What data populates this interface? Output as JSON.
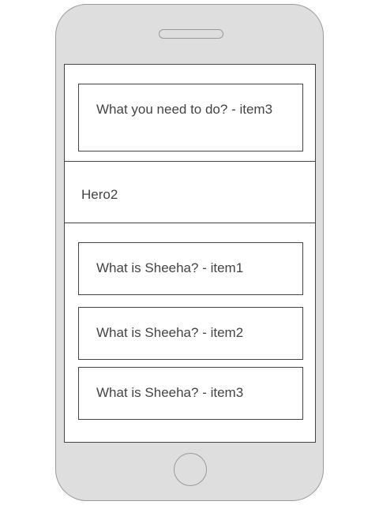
{
  "top_card": {
    "label": "What you need to do? - item3"
  },
  "hero": {
    "label": "Hero2"
  },
  "items": [
    {
      "label": "What is Sheeha? - item1"
    },
    {
      "label": "What is Sheeha? - item2"
    },
    {
      "label": "What is Sheeha? - item3"
    }
  ]
}
